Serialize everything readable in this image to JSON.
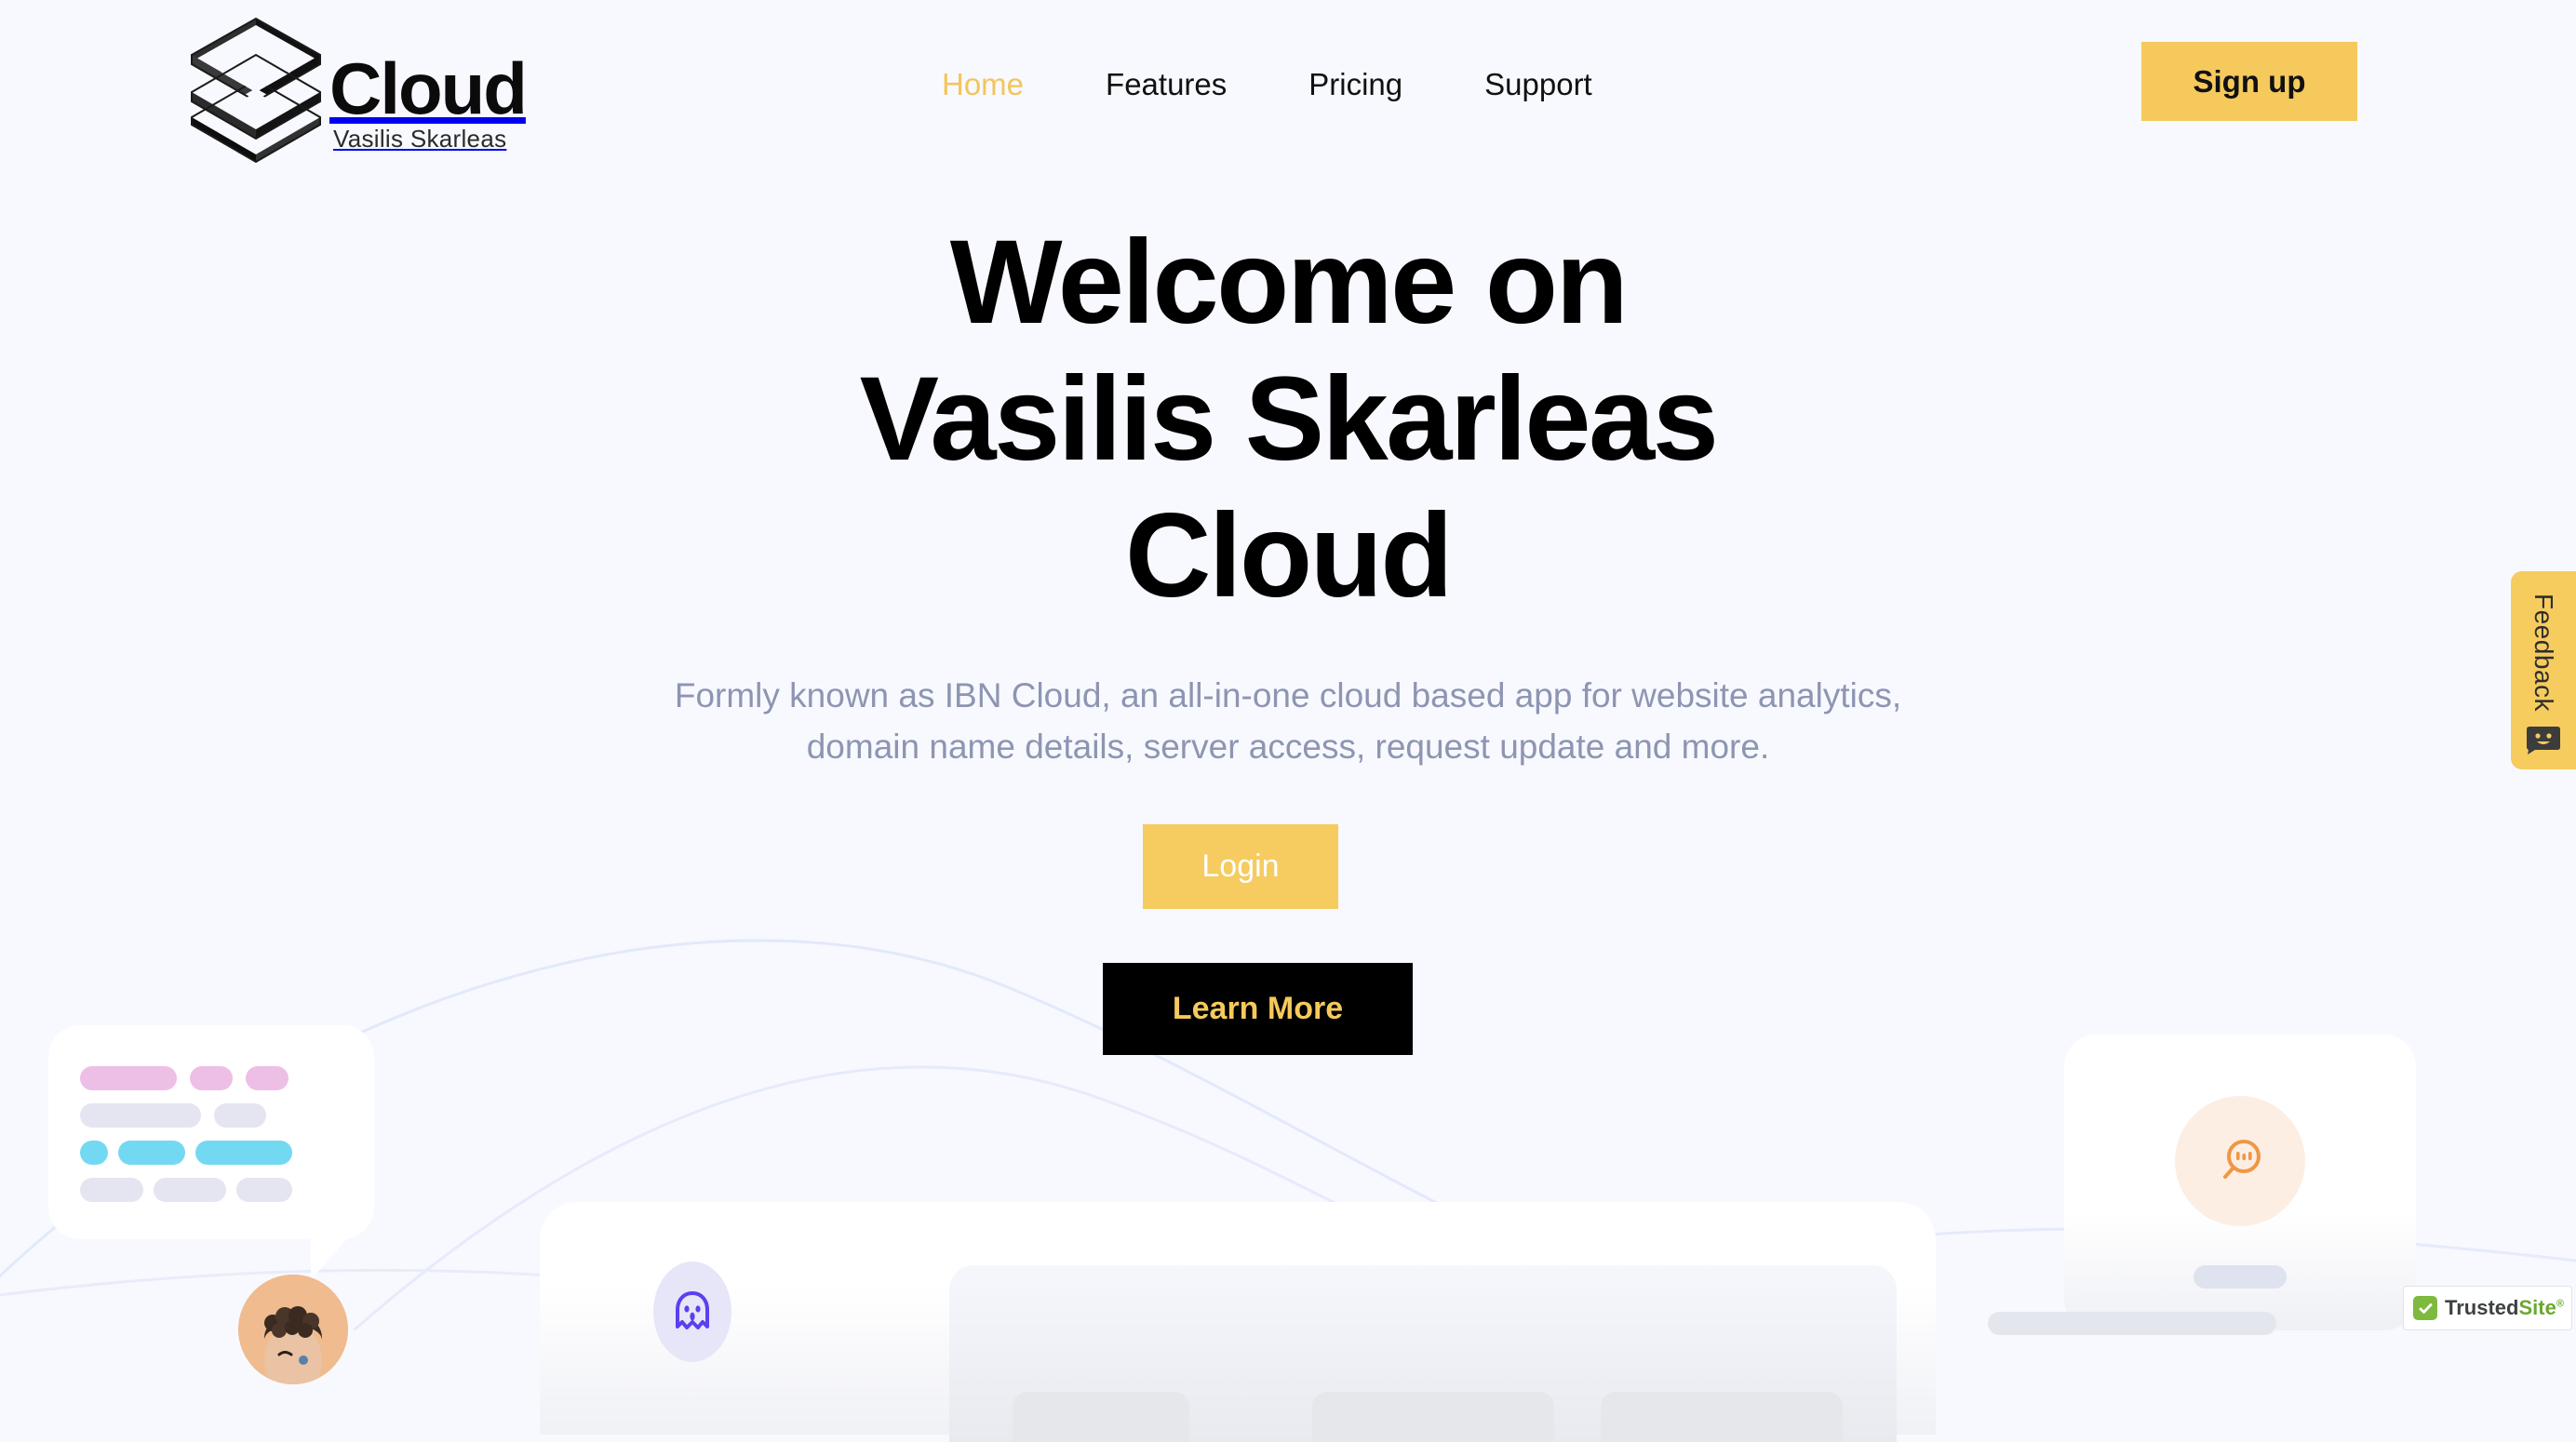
{
  "theme": {
    "page_bg": "#f7f9fe",
    "accent_yellow": "#f5c95c",
    "accent_yellow_soft": "#f6cb5f",
    "text_dark": "#000000",
    "text_muted": "#8d95b2",
    "black": "#000000"
  },
  "navbar": {
    "logo": {
      "word": "Cloud",
      "subtitle": "Vasilis Skarleas",
      "mark_name": "isometric-hexagon-logo-mark"
    },
    "links": [
      {
        "label": "Home",
        "active": true
      },
      {
        "label": "Features",
        "active": false
      },
      {
        "label": "Pricing",
        "active": false
      },
      {
        "label": "Support",
        "active": false
      }
    ],
    "signup_label": "Sign up"
  },
  "hero": {
    "title_line1": "Welcome on",
    "title_line2": "Vasilis Skarleas",
    "title_line3": "Cloud",
    "subtitle_line1": "Formly known as IBN Cloud, an all-in-one cloud based app for website analytics,",
    "subtitle_line2": "domain name details, server access, request update and more.",
    "login_label": "Login",
    "learn_more_label": "Learn More"
  },
  "decor": {
    "left_card": {
      "name": "chat-bubble-placeholder-card",
      "rows": [
        {
          "color": "#edbfe6",
          "widths": [
            104,
            46,
            46
          ]
        },
        {
          "color": "#e4e5f0",
          "widths": [
            130,
            56
          ]
        },
        {
          "color": "#73d9f2",
          "widths": [
            30,
            72,
            104
          ]
        },
        {
          "color": "#e4e5f0",
          "widths": [
            68,
            78,
            46
          ]
        }
      ]
    },
    "center_card": {
      "name": "dashboard-placeholder-card",
      "icon": "ghost-icon",
      "icon_color": "#5b3ff0",
      "icon_bg": "#e7e6f8",
      "tiles": 3
    },
    "right_card": {
      "name": "search-chat-placeholder-card",
      "icon": "chat-search-icon",
      "icon_color": "#ef9745",
      "icon_bg": "#fdeee4"
    },
    "avatar": {
      "name": "user-avatar",
      "bg": "#f0bb8e"
    }
  },
  "feedback": {
    "label": "Feedback",
    "icon": "smiley-chat-icon",
    "bg": "#f5cc5d"
  },
  "trusted_site": {
    "brand_first": "Trusted",
    "brand_second": "Site",
    "registered_mark": "®",
    "check_icon": "check-icon",
    "check_bg": "#7dba3e"
  }
}
